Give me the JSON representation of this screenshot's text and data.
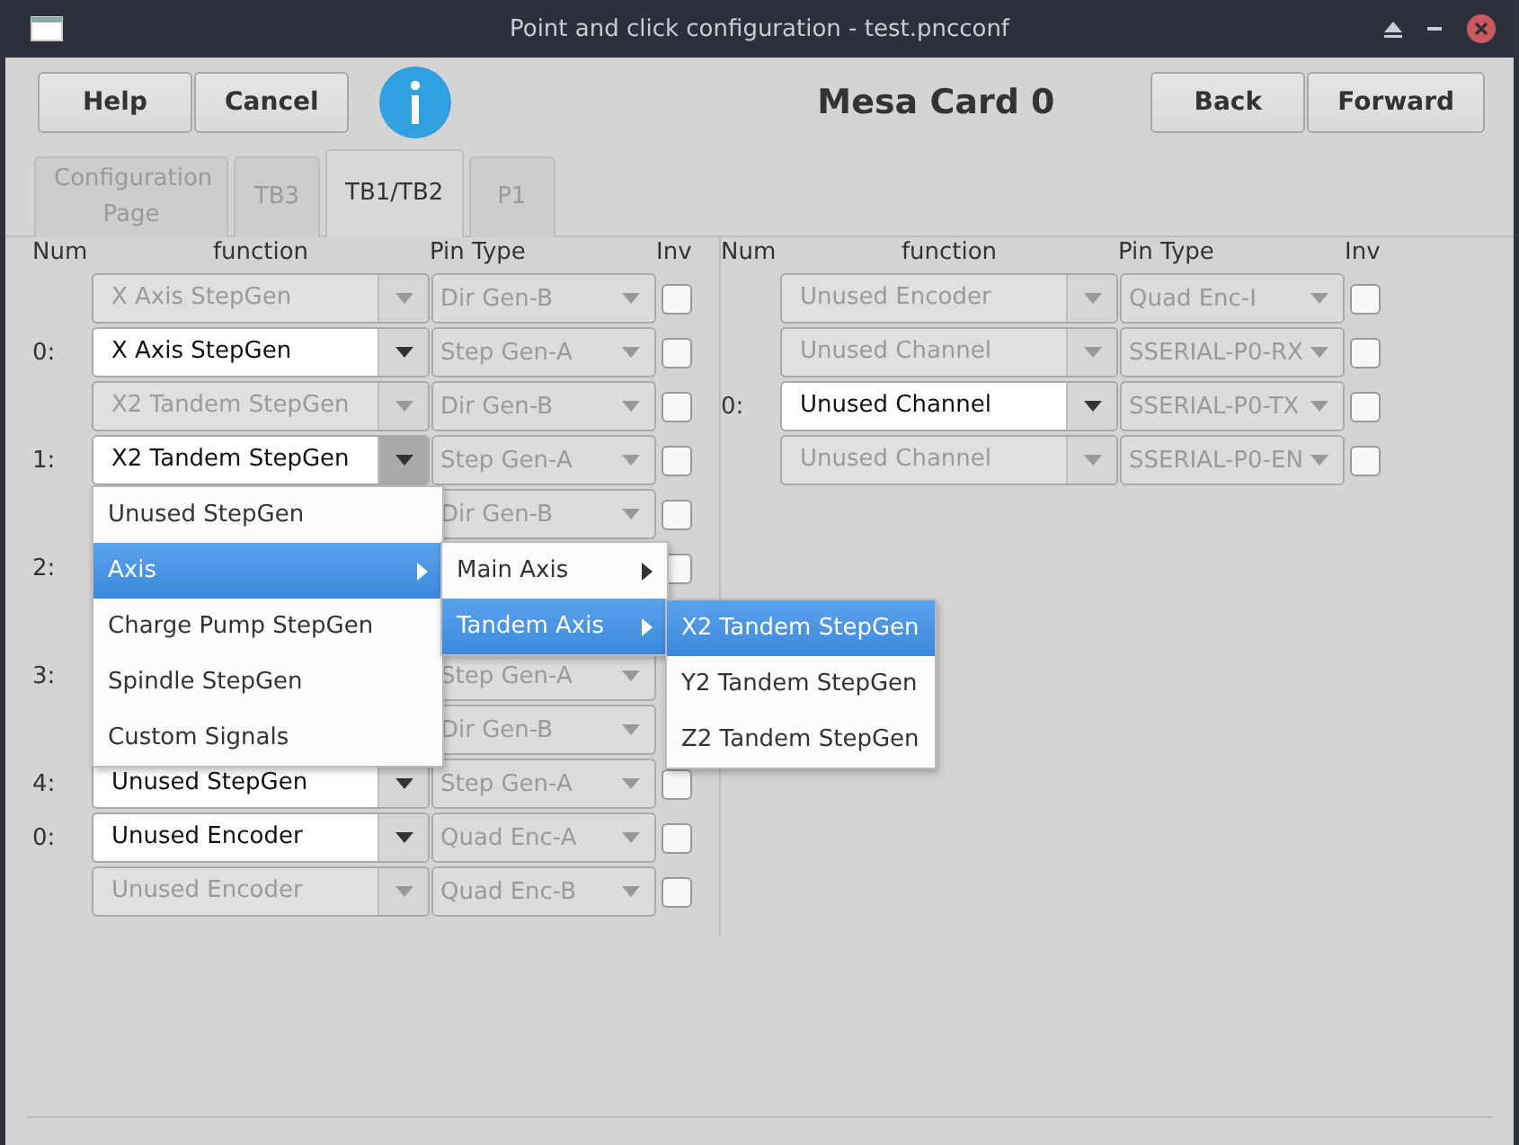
{
  "window": {
    "title": "Point and click configuration - test.pncconf"
  },
  "toolbar": {
    "left_buttons": [
      "Help",
      "Cancel"
    ],
    "heading": "Mesa Card 0",
    "right_buttons": [
      "Back",
      "Forward"
    ]
  },
  "tabs": [
    {
      "label": "Configuration Page",
      "selected": false
    },
    {
      "label": "TB3",
      "selected": false
    },
    {
      "label": "TB1/TB2",
      "selected": true
    },
    {
      "label": "P1",
      "selected": false
    }
  ],
  "panels": [
    {
      "columns": [
        "Num",
        "function",
        "Pin Type",
        "Inv"
      ],
      "rows": [
        {
          "function": "X Axis StepGen",
          "enabled": false,
          "pin_type": "Dir Gen-B",
          "inv": false
        },
        {
          "num": "0:",
          "function": "X Axis StepGen",
          "enabled": true,
          "pin_type": "Step Gen-A",
          "inv": false
        },
        {
          "function": "X2 Tandem StepGen",
          "enabled": false,
          "pin_type": "Dir Gen-B",
          "inv": false
        },
        {
          "num": "1:",
          "function": "X2 Tandem StepGen",
          "enabled": true,
          "open": true,
          "pin_type": "Step Gen-A",
          "inv": false
        },
        {
          "pin_type": "Dir Gen-B",
          "inv": false
        },
        {
          "num": "2:",
          "inv": false
        },
        {},
        {
          "num": "3:",
          "pin_type": "Step Gen-A"
        },
        {
          "pin_type": "Dir Gen-B"
        },
        {
          "num": "4:",
          "function": "Unused StepGen",
          "enabled": true,
          "pin_type": "Step Gen-A",
          "inv": false
        },
        {
          "num": "0:",
          "function": "Unused Encoder",
          "enabled": true,
          "pin_type": "Quad Enc-A",
          "inv": false
        },
        {
          "function": "Unused Encoder",
          "enabled": false,
          "pin_type": "Quad Enc-B",
          "inv": false
        }
      ]
    },
    {
      "columns": [
        "Num",
        "function",
        "Pin Type",
        "Inv"
      ],
      "rows": [
        {
          "function": "Unused Encoder",
          "enabled": false,
          "pin_type": "Quad Enc-I",
          "inv": false
        },
        {
          "function": "Unused Channel",
          "enabled": false,
          "pin_type": "SSERIAL-P0-RX",
          "inv": false
        },
        {
          "num": "0:",
          "function": "Unused Channel",
          "enabled": true,
          "pin_type": "SSERIAL-P0-TX",
          "inv": false
        },
        {
          "function": "Unused Channel",
          "enabled": false,
          "pin_type": "SSERIAL-P0-EN",
          "inv": false
        }
      ]
    }
  ],
  "menus": [
    {
      "items": [
        {
          "label": "Unused StepGen",
          "submenu": false,
          "selected": false
        },
        {
          "label": "Axis",
          "submenu": true,
          "selected": true
        },
        {
          "label": "Charge Pump StepGen",
          "submenu": false,
          "selected": false
        },
        {
          "label": "Spindle StepGen",
          "submenu": false,
          "selected": false
        },
        {
          "label": "Custom Signals",
          "submenu": false,
          "selected": false
        }
      ]
    },
    {
      "items": [
        {
          "label": "Main Axis",
          "submenu": true,
          "selected": false
        },
        {
          "label": "Tandem Axis",
          "submenu": true,
          "selected": true
        }
      ]
    },
    {
      "items": [
        {
          "label": "X2 Tandem StepGen",
          "submenu": false,
          "selected": true
        },
        {
          "label": "Y2 Tandem StepGen",
          "submenu": false,
          "selected": false
        },
        {
          "label": "Z2 Tandem StepGen",
          "submenu": false,
          "selected": false
        }
      ]
    }
  ]
}
